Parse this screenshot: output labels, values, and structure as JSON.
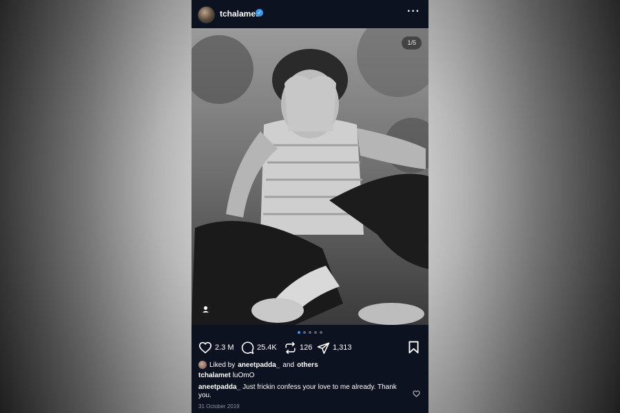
{
  "post": {
    "username": "tchalamet",
    "photo_counter": "1/5",
    "caption_user": "tchalamet",
    "caption_text": "luOmO",
    "date": "31 October 2019"
  },
  "stats": {
    "likes": "2.3 M",
    "comments": "25.4K",
    "reposts": "126",
    "shares": "1,313"
  },
  "liked_by": {
    "prefix": "Liked by",
    "user": "aneetpadda_",
    "and": "and",
    "others": "others"
  },
  "comment": {
    "user": "aneetpadda_",
    "text": "Just frickin confess your love to me already. Thank you."
  },
  "carousel": {
    "count": 5,
    "active": 1
  },
  "colors": {
    "accent": "#3897f0",
    "bg": "#0c1220"
  },
  "icons": [
    "verified-badge-icon",
    "more-icon",
    "user-tag-icon",
    "heart-icon",
    "comment-icon",
    "repost-icon",
    "share-icon",
    "bookmark-icon",
    "heart-small-icon"
  ]
}
